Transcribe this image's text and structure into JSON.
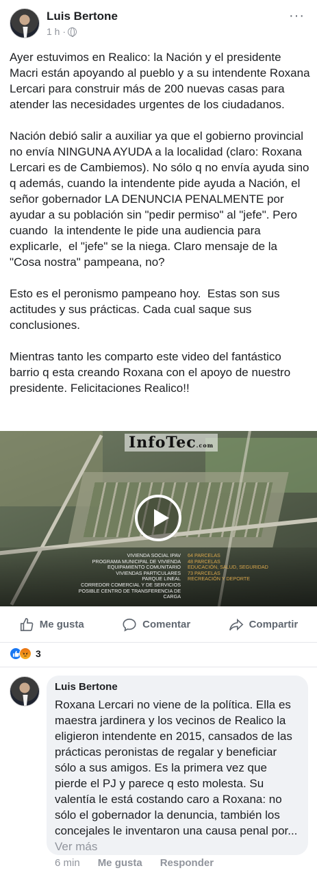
{
  "post": {
    "author": "Luis Bertone",
    "time": "1 h ·",
    "icons": {
      "audience": "globe-icon",
      "more": "more-options-icon"
    },
    "paragraphs": [
      "Ayer estuvimos en Realico: la Nación y el presidente Macri están apoyando al pueblo y a su intendente Roxana Lercari para construir más de 200 nuevas casas para atender las necesidades urgentes de los ciudadanos.",
      "Nación debió salir a auxiliar ya que el gobierno provincial no envía NINGUNA AYUDA a la localidad (claro: Roxana Lercari es de Cambiemos). No sólo q no envía ayuda sino q además, cuando la intendente pide ayuda a Nación, el señor gobernador LA DENUNCIA PENALMENTE por ayudar a su población sin \"pedir permiso\" al \"jefe\". Pero cuando  la intendente le pide una audiencia para explicarle,  el \"jefe\" se la niega. Claro mensaje de la \"Cosa nostra\" pampeana, no?",
      "Esto es el peronismo pampeano hoy.  Estas son sus actitudes y sus prácticas. Cada cual saque sus conclusiones.",
      "Mientras tanto les comparto este video del fantástico barrio q esta creando Roxana con el apoyo de nuestro presidente. Felicitaciones Realico!!"
    ]
  },
  "video": {
    "watermark": "InfoTec",
    "watermark_sub": ".com",
    "legend": [
      {
        "label": "Vivienda social IPAV",
        "value": "64 parcelas"
      },
      {
        "label": "Programa municipal de vivienda",
        "value": "48 parcelas"
      },
      {
        "label": "Equipamiento comunitario",
        "value": "educación, salud, seguridad"
      },
      {
        "label": "Viviendas particulares",
        "value": "73 parcelas"
      },
      {
        "label": "Parque lineal",
        "value": "recreación y deporte"
      },
      {
        "label": "Corredor comercial y de servicios",
        "value": ""
      },
      {
        "label": "Posible centro de transferencia de carga",
        "value": ""
      }
    ]
  },
  "actions": {
    "like": "Me gusta",
    "comment": "Comentar",
    "share": "Compartir"
  },
  "reactions": {
    "count": "3"
  },
  "comment": {
    "author": "Luis Bertone",
    "text": "Roxana Lercari no viene de la política. Ella es maestra jardinera y los vecinos de Realico la eligieron intendente en 2015, cansados de las prácticas peronistas de regalar y beneficiar sólo a sus amigos. Es la primera vez que pierde el PJ y parece q esto molesta. Su valentía le está costando caro a Roxana: no sólo el gobernador la denuncia, también los concejales le inventaron una causa penal por... ",
    "see_more": "Ver más",
    "time": "6 min",
    "like": "Me gusta",
    "reply": "Responder"
  }
}
